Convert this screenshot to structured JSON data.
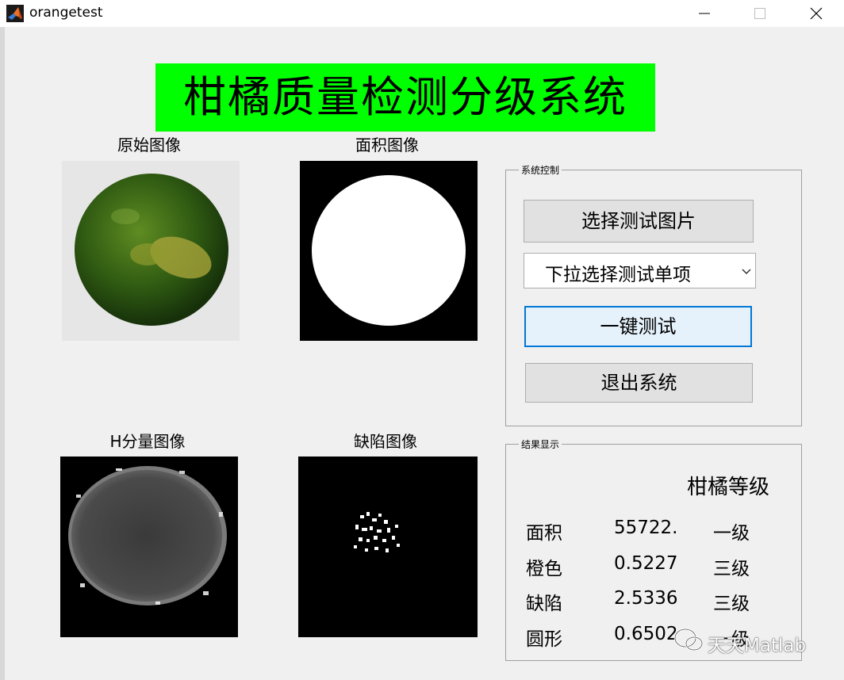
{
  "window": {
    "title": "orangetest"
  },
  "main_title": "柑橘质量检测分级系统",
  "images": {
    "original": {
      "caption": "原始图像"
    },
    "area": {
      "caption": "面积图像"
    },
    "h_component": {
      "caption": "H分量图像"
    },
    "defect": {
      "caption": "缺陷图像"
    }
  },
  "control_panel": {
    "legend": "系统控制",
    "select_image_button": "选择测试图片",
    "dropdown_value": "下拉选择测试单项",
    "one_click_test_button": "一键测试",
    "exit_button": "退出系统"
  },
  "result_panel": {
    "legend": "结果显示",
    "grade_header": "柑橘等级",
    "rows": [
      {
        "label": "面积",
        "value": "55722.",
        "grade": "一级"
      },
      {
        "label": "橙色",
        "value": "0.5227",
        "grade": "三级"
      },
      {
        "label": "缺陷",
        "value": "2.5336",
        "grade": "三级"
      },
      {
        "label": "圆形",
        "value": "0.6502",
        "grade": "一级"
      }
    ]
  },
  "watermark": {
    "text": "天天Matlab"
  },
  "colors": {
    "title_bg": "#00ff00",
    "focus_border": "#0078d7",
    "window_bg": "#f0f0f0"
  }
}
